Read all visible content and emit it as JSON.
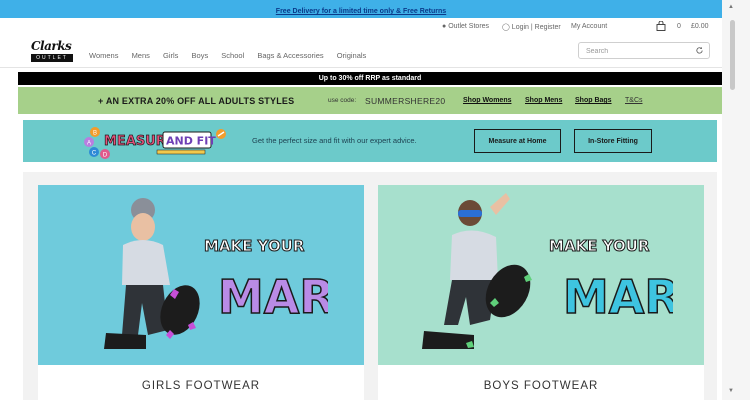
{
  "topbar": {
    "delivery_link": "Free Delivery for a limited time only & Free Returns"
  },
  "utility": {
    "outlet_stores": "Outlet Stores",
    "login": "Login | Register",
    "account": "My Account",
    "bag_count": "0",
    "bag_total": "£0.00"
  },
  "header": {
    "logo_text": "Clarks",
    "logo_badge": "OUTLET",
    "nav": [
      "Womens",
      "Mens",
      "Girls",
      "Boys",
      "School",
      "Bags & Accessories",
      "Originals"
    ],
    "search_placeholder": "Search"
  },
  "promo_black": {
    "text": "Up to 30% off RRP as standard"
  },
  "promo_green": {
    "headline": "+ AN EXTRA 20% OFF  ALL ADULTS STYLES",
    "use_code": "use code:",
    "code": "SUMMERSHERE20",
    "links": [
      "Shop Womens",
      "Shop Mens",
      "Shop Bags",
      "T&Cs"
    ]
  },
  "measure": {
    "logo_word1": "MEASURE",
    "logo_word2": "AND FIT",
    "ruler_letters": [
      "A",
      "B",
      "C",
      "D"
    ],
    "text": "Get the perfect size and fit with our expert advice.",
    "btn_home": "Measure at Home",
    "btn_store": "In-Store Fitting"
  },
  "cards": [
    {
      "label": "GIRLS FOOTWEAR",
      "slogan1": "MAKE YOUR",
      "slogan2": "MARK",
      "bg": "#6fcbdc",
      "mark_color": "#b98be6"
    },
    {
      "label": "BOYS FOOTWEAR",
      "slogan1": "MAKE YOUR",
      "slogan2": "MARK",
      "bg": "#a7e0cd",
      "mark_color": "#3ec4e0"
    }
  ],
  "colors": {
    "topbar": "#3fb0e8",
    "promo_green": "#a6d08a",
    "measure_bg": "#6ccaca"
  }
}
